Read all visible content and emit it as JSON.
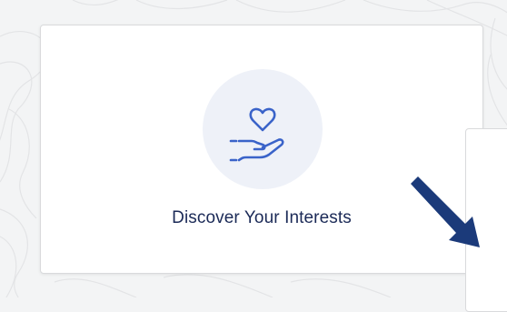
{
  "background": {
    "color": "#f3f4f5",
    "pattern": "topographic-lines"
  },
  "card": {
    "title": "Discover Your Interests",
    "icon": "heart-in-hand-icon",
    "icon_color": "#3a63c9",
    "icon_bg": "#eef1f8",
    "title_color": "#1b2a57"
  },
  "secondary_card": {
    "visible": true
  },
  "pointer": {
    "icon": "diagonal-arrow-icon",
    "color": "#1b3a7a",
    "direction": "down-right"
  }
}
